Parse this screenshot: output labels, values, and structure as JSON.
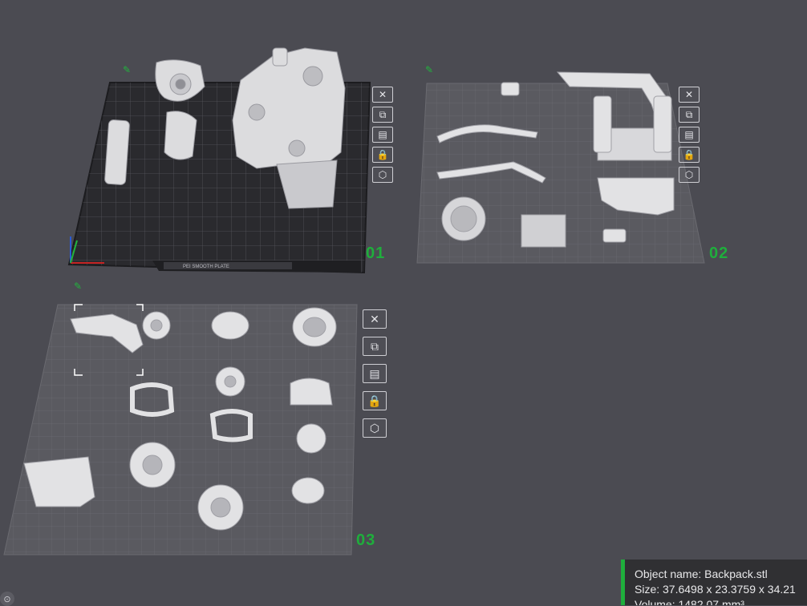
{
  "viewport": {
    "background": "#4b4b52"
  },
  "plates": [
    {
      "number": "01",
      "type": "textured-dark"
    },
    {
      "number": "02",
      "type": "smooth-light"
    },
    {
      "number": "03",
      "type": "smooth-light"
    }
  ],
  "plate_tools": [
    {
      "name": "delete-plate",
      "icon": "close-icon",
      "glyph": "✕"
    },
    {
      "name": "auto-arrange",
      "icon": "arrange-icon",
      "glyph": "⧉"
    },
    {
      "name": "plate-settings",
      "icon": "settings-icon",
      "glyph": "▤"
    },
    {
      "name": "lock-plate",
      "icon": "lock-icon",
      "glyph": "🔒"
    },
    {
      "name": "toggle-visibility",
      "icon": "eye-icon",
      "glyph": "⬡"
    }
  ],
  "plate1": {
    "bed_label": "PEI SMOOTH PLATE"
  },
  "info_panel": {
    "object_name": "Object name: Backpack.stl",
    "size": "Size: 37.6498 x 23.3759 x 34.21",
    "volume": "Volume: 1482.07 mm³"
  },
  "accent_color": "#1fae3c"
}
